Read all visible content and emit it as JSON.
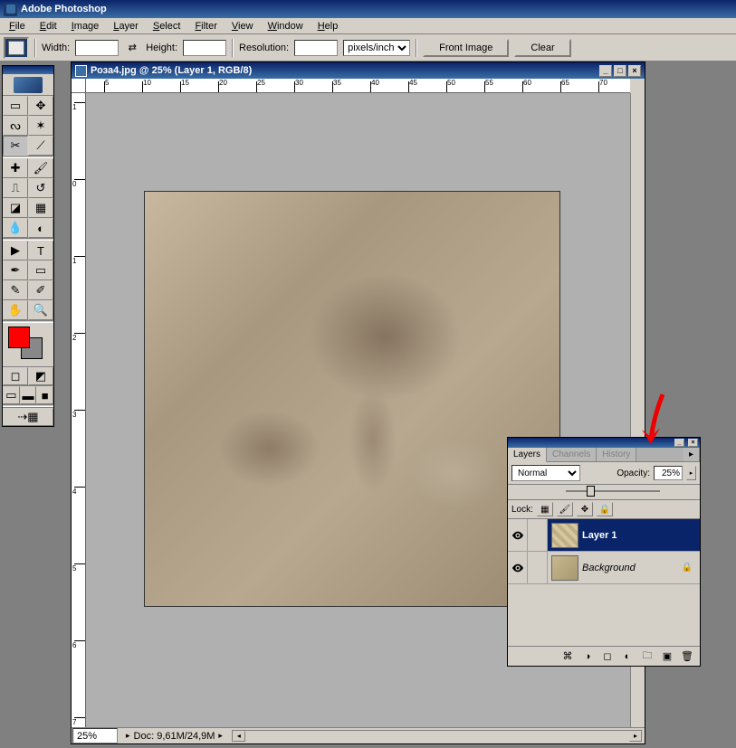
{
  "app": {
    "title": "Adobe Photoshop"
  },
  "menu": {
    "items": [
      "File",
      "Edit",
      "Image",
      "Layer",
      "Select",
      "Filter",
      "View",
      "Window",
      "Help"
    ]
  },
  "options": {
    "width_label": "Width:",
    "width_value": "",
    "height_label": "Height:",
    "height_value": "",
    "resolution_label": "Resolution:",
    "resolution_value": "",
    "units": "pixels/inch",
    "front_image": "Front Image",
    "clear": "Clear"
  },
  "document": {
    "title": "Роза4.jpg @ 25% (Layer 1, RGB/8)",
    "zoom": "25%",
    "doc_size": "Doc: 9,61M/24,9M",
    "ruler_h": [
      "5",
      "10",
      "15",
      "20",
      "25",
      "30",
      "35",
      "40",
      "45",
      "50",
      "55",
      "60",
      "65",
      "70"
    ],
    "ruler_v": [
      "1",
      "0",
      "1",
      "2",
      "3",
      "4",
      "5",
      "6",
      "7"
    ]
  },
  "layers_panel": {
    "tabs": {
      "layers": "Layers",
      "channels": "Channels",
      "history": "History"
    },
    "blend_mode": "Normal",
    "opacity_label": "Opacity:",
    "opacity_value": "25%",
    "lock_label": "Lock:",
    "layers": [
      {
        "name": "Layer 1",
        "visible": true,
        "selected": true,
        "locked": false
      },
      {
        "name": "Background",
        "visible": true,
        "selected": false,
        "locked": true
      }
    ]
  },
  "toolbox": {
    "tools": [
      "rectangular-marquee",
      "move",
      "lasso",
      "magic-wand",
      "crop",
      "slice",
      "healing-brush",
      "brush",
      "clone-stamp",
      "history-brush",
      "eraser",
      "gradient",
      "blur",
      "dodge",
      "path-select",
      "type",
      "pen",
      "shape",
      "notes",
      "eyedropper",
      "hand",
      "zoom"
    ],
    "fg_color": "#ff0000",
    "bg_color": "#888888"
  }
}
